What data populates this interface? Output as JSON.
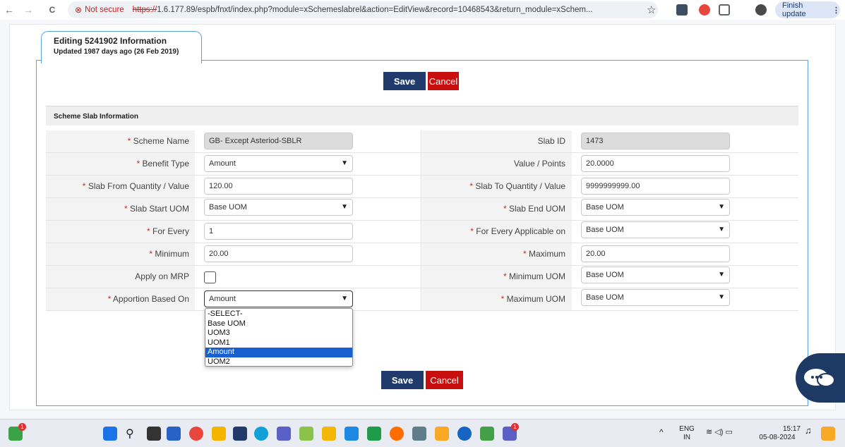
{
  "browser": {
    "back": "←",
    "forward": "→",
    "reload": "C",
    "not_secure": "Not secure",
    "url_scheme": "https://",
    "url_rest": "1.6.177.89/espb/fnxt/index.php?module=xSchemeslabrel&action=EditView&record=10468543&return_module=xSchem...",
    "finish_update": "Finish update"
  },
  "tab": {
    "title": "Editing 5241902 Information",
    "subtitle": "Updated 1987 days ago (26 Feb 2019)"
  },
  "buttons": {
    "save": "Save",
    "cancel": "Cancel"
  },
  "section": {
    "title": "Scheme Slab Information"
  },
  "required_mark": "* ",
  "fields": {
    "scheme_name": {
      "label": "Scheme Name",
      "value": "GB- Except Asteriod-SBLR"
    },
    "slab_id": {
      "label": "Slab ID",
      "value": "1473"
    },
    "benefit_type": {
      "label": "Benefit Type",
      "value": "Amount"
    },
    "value_points": {
      "label": "Value / Points",
      "value": "20.0000"
    },
    "slab_from": {
      "label": "Slab From Quantity / Value",
      "value": "120.00"
    },
    "slab_to": {
      "label": "Slab To Quantity / Value",
      "value": "9999999999.00"
    },
    "slab_start_uom": {
      "label": "Slab Start UOM",
      "value": "Base UOM"
    },
    "slab_end_uom": {
      "label": "Slab End UOM",
      "value": "Base UOM"
    },
    "for_every": {
      "label": "For Every",
      "value": "1"
    },
    "for_every_applicable": {
      "label": "For Every Applicable on",
      "value": "Base UOM"
    },
    "minimum": {
      "label": "Minimum",
      "value": "20.00"
    },
    "maximum": {
      "label": "Maximum",
      "value": "20.00"
    },
    "apply_mrp": {
      "label": "Apply on MRP",
      "checked": false
    },
    "minimum_uom": {
      "label": "Minimum UOM",
      "value": "Base UOM"
    },
    "apportion": {
      "label": "Apportion Based On",
      "value": "Amount"
    },
    "maximum_uom": {
      "label": "Maximum UOM",
      "value": "Base UOM"
    }
  },
  "dropdown_options": [
    "-SELECT-",
    "Base UOM",
    "UOM3",
    "UOM1",
    "Amount",
    "UOM2"
  ],
  "dropdown_selected_index": 4,
  "taskbar": {
    "lang_top": "ENG",
    "lang_bottom": "IN",
    "time": "15:17",
    "date": "05-08-2024",
    "badge_left": "1",
    "badge_right": "1"
  },
  "colors": {
    "save": "#1f3a6b",
    "cancel": "#c90e0e",
    "panel_border": "#5aa3d8",
    "required": "#e02020",
    "selected_option": "#1a5fd0"
  }
}
